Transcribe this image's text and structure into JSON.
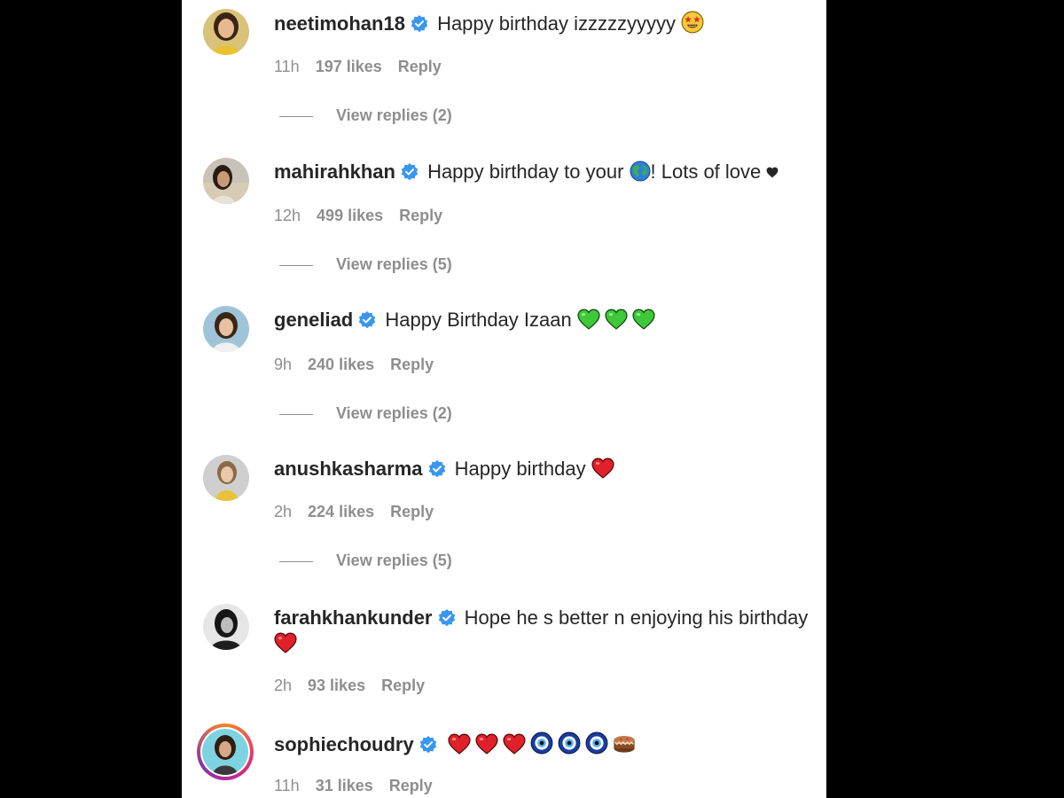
{
  "colors": {
    "background": "#000000",
    "panel": "#ffffff",
    "text": "#262626",
    "muted": "#8e8e8e",
    "verified": "#3897f0"
  },
  "comments": [
    {
      "username": "neetimohan18",
      "verified": true,
      "text": "Happy birthday izzzzzyyyyy",
      "emojis": [
        "star-struck-emoji"
      ],
      "time": "11h",
      "likes": "197 likes",
      "reply": "Reply",
      "view_replies": "View replies (2)"
    },
    {
      "username": "mahirahkhan",
      "verified": true,
      "text": "Happy birthday to your",
      "text_after": "! Lots of love",
      "emojis": [
        "globe-emoji",
        "black-heart-emoji"
      ],
      "time": "12h",
      "likes": "499 likes",
      "reply": "Reply",
      "view_replies": "View replies (5)"
    },
    {
      "username": "geneliad",
      "verified": true,
      "text": "Happy Birthday Izaan",
      "emojis": [
        "green-heart-emoji",
        "green-heart-emoji",
        "green-heart-emoji"
      ],
      "time": "9h",
      "likes": "240 likes",
      "reply": "Reply",
      "view_replies": "View replies (2)"
    },
    {
      "username": "anushkasharma",
      "verified": true,
      "text": "Happy birthday",
      "emojis": [
        "red-heart-emoji"
      ],
      "time": "2h",
      "likes": "224 likes",
      "reply": "Reply",
      "view_replies": "View replies (5)"
    },
    {
      "username": "farahkhankunder",
      "verified": true,
      "text": "Hope he s better n enjoying his birthday",
      "emojis": [
        "red-heart-emoji"
      ],
      "time": "2h",
      "likes": "93 likes",
      "reply": "Reply"
    },
    {
      "username": "sophiechoudry",
      "verified": true,
      "text": "",
      "emojis": [
        "red-heart-emoji",
        "red-heart-emoji",
        "red-heart-emoji",
        "nazar-amulet-emoji",
        "nazar-amulet-emoji",
        "nazar-amulet-emoji",
        "cake-emoji"
      ],
      "time": "11h",
      "likes": "31 likes",
      "reply": "Reply"
    }
  ]
}
